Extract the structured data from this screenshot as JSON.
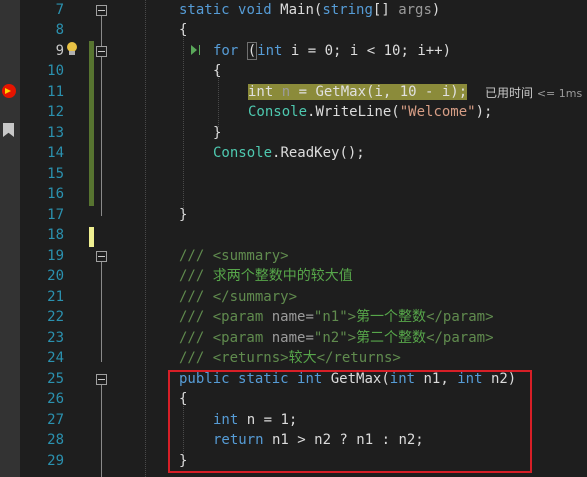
{
  "lines": [
    {
      "n": "7",
      "active": false
    },
    {
      "n": "8",
      "active": false
    },
    {
      "n": "9",
      "active": true
    },
    {
      "n": "10",
      "active": false
    },
    {
      "n": "11",
      "active": false
    },
    {
      "n": "12",
      "active": false
    },
    {
      "n": "13",
      "active": false
    },
    {
      "n": "14",
      "active": false
    },
    {
      "n": "15",
      "active": false
    },
    {
      "n": "16",
      "active": false
    },
    {
      "n": "17",
      "active": false
    },
    {
      "n": "18",
      "active": false
    },
    {
      "n": "19",
      "active": false
    },
    {
      "n": "20",
      "active": false
    },
    {
      "n": "21",
      "active": false
    },
    {
      "n": "22",
      "active": false
    },
    {
      "n": "23",
      "active": false
    },
    {
      "n": "24",
      "active": false
    },
    {
      "n": "25",
      "active": false
    },
    {
      "n": "26",
      "active": false
    },
    {
      "n": "27",
      "active": false
    },
    {
      "n": "28",
      "active": false
    },
    {
      "n": "29",
      "active": false
    }
  ],
  "code": {
    "l7": {
      "kw1": "static",
      "kw2": "void",
      "name": " Main(",
      "kw3": "string",
      "rest": "[] ",
      "arg": "args",
      ")": ")"
    },
    "l8": "{",
    "l9": {
      "kw": "for",
      "open": "(",
      "kw2": "int",
      "rest": " i = 0; i < 10; i++)"
    },
    "l10": "{",
    "l11": {
      "kw": "int",
      "var": " n",
      "rest": " = GetMax(i, 10 - i);"
    },
    "l12": {
      "obj": "Console",
      "call": ".WriteLine(",
      "str": "\"Welcome\"",
      "end": ");"
    },
    "l13": "}",
    "l14": {
      "obj": "Console",
      "call": ".ReadKey();"
    },
    "l17": "}",
    "l19": {
      "cm": "/// ",
      "tag": "<summary>"
    },
    "l20": {
      "cm": "/// ",
      "txt": "求两个整数中的较大值"
    },
    "l21": {
      "cm": "/// ",
      "tag": "</summary>"
    },
    "l22": {
      "cm": "/// ",
      "open": "<param ",
      "attr": "name=",
      "q": "\"",
      "val": "n1",
      "q2": "\"",
      "close": ">",
      "txt": "第一个整数",
      "end": "</param>"
    },
    "l23": {
      "cm": "/// ",
      "open": "<param ",
      "attr": "name=",
      "q": "\"",
      "val": "n2",
      "q2": "\"",
      "close": ">",
      "txt": "第二个整数",
      "end": "</param>"
    },
    "l24": {
      "cm": "/// ",
      "open": "<returns>",
      "txt": "较大",
      "end": "</returns>"
    },
    "l25": {
      "kw1": "public",
      "kw2": "static",
      "kw3": "int",
      "name": " GetMax(",
      "kw4": "int",
      "p1": " n1, ",
      "kw5": "int",
      "p2": " n2)"
    },
    "l26": "{",
    "l27": {
      "kw": "int",
      "rest": " n = 1;"
    },
    "l28": {
      "kw": "return",
      "rest": " n1 > n2 ? n1 : n2;"
    },
    "l29": "}"
  },
  "perf_tip": {
    "label": "已用时间",
    "ms": "<= 1ms"
  },
  "icons": {
    "breakpoint": "current-statement-breakpoint-icon",
    "bookmark": "bookmark-icon",
    "lightbulb": "lightbulb-icon"
  }
}
